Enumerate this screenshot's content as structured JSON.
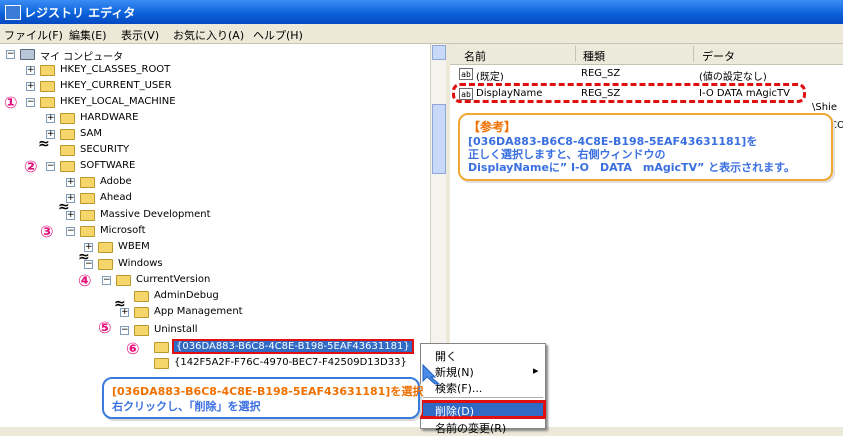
{
  "window": {
    "title": "レジストリ エディタ"
  },
  "menu": [
    "ファイル(F)",
    "編集(E)",
    "表示(V)",
    "お気に入り(A)",
    "ヘルプ(H)"
  ],
  "tree": [
    {
      "label": "マイ コンピュータ",
      "expander": "−",
      "kind": "computer"
    },
    {
      "label": "HKEY_CLASSES_ROOT",
      "expander": "+"
    },
    {
      "label": "HKEY_CURRENT_USER",
      "expander": "+"
    },
    {
      "label": "HKEY_LOCAL_MACHINE",
      "expander": "−"
    },
    {
      "label": "HARDWARE",
      "expander": "+"
    },
    {
      "label": "SAM",
      "expander": "+"
    },
    {
      "label": "SECURITY",
      "expander": ""
    },
    {
      "label": "SOFTWARE",
      "expander": "−"
    },
    {
      "label": "Adobe",
      "expander": "+"
    },
    {
      "label": "Ahead",
      "expander": "+"
    },
    {
      "label": "Massive Development",
      "expander": "+"
    },
    {
      "label": "Microsoft",
      "expander": "−"
    },
    {
      "label": "WBEM",
      "expander": "+"
    },
    {
      "label": "Windows",
      "expander": "−"
    },
    {
      "label": "CurrentVersion",
      "expander": "−"
    },
    {
      "label": "AdminDebug",
      "expander": ""
    },
    {
      "label": "App Management",
      "expander": "+"
    },
    {
      "label": "Uninstall",
      "expander": "−"
    },
    {
      "label": "{036DA883-B6C8-4C8E-B198-5EAF43631181}",
      "expander": "",
      "selected": true
    },
    {
      "label": "{142F5A2F-F76C-4970-BEC7-F42509D13D33}",
      "expander": ""
    },
    {
      "label": "",
      "expander": ""
    }
  ],
  "markers": [
    "①",
    "②",
    "③",
    "④",
    "⑤",
    "⑥"
  ],
  "squiggle": "≈",
  "list": {
    "headers": [
      "名前",
      "種類",
      "データ"
    ],
    "rows": [
      {
        "icon": "ab",
        "name": "(既定)",
        "type": "REG_SZ",
        "data": "(値の設定なし)"
      },
      {
        "icon": "ab",
        "name": "DisplayName",
        "type": "REG_SZ",
        "data": "I-O DATA mAgicTV"
      }
    ],
    "cut_text": [
      "\\Shie",
      "CO"
    ]
  },
  "note": {
    "heading": "【参考】",
    "line1": "[036DA883-B6C8-4C8E-B198-5EAF43631181]を",
    "line2": "正しく選択しますと、右側ウィンドウの",
    "line3": "DisplayNameに” I-O　DATA　mAgicTV” と表示されます。"
  },
  "instruction": {
    "line1": "[036DA883-B6C8-4C8E-B198-5EAF43631181]を選択",
    "line2": "右クリックし、「削除」を選択"
  },
  "context_menu": {
    "items": [
      "開く",
      "新規(N)",
      "検索(F)...",
      "削除(D)",
      "名前の変更(R)"
    ]
  },
  "colors": {
    "accent": "#e6127d",
    "note_border": "#f0a830",
    "note_text": "#3a6fe0",
    "instruction_border": "#3a7bde",
    "highlight_red": "#e01010",
    "selection": "#316ac5"
  }
}
